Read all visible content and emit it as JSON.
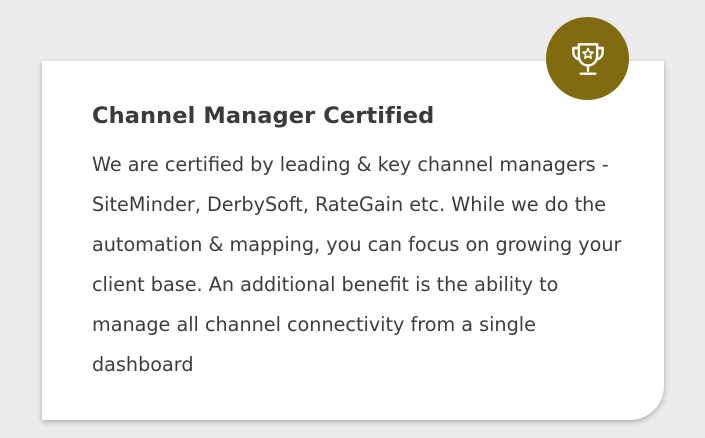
{
  "card": {
    "title": "Channel Manager Certified",
    "description": "We are certified by leading & key channel managers - SiteMinder, DerbySoft, RateGain etc. While we do the automation & mapping, you can focus on growing your client base. An additional benefit is the ability to manage all channel connectivity from a single dashboard"
  },
  "badge": {
    "icon": "trophy-icon",
    "color": "#826a10",
    "icon_color": "#ffffff"
  }
}
